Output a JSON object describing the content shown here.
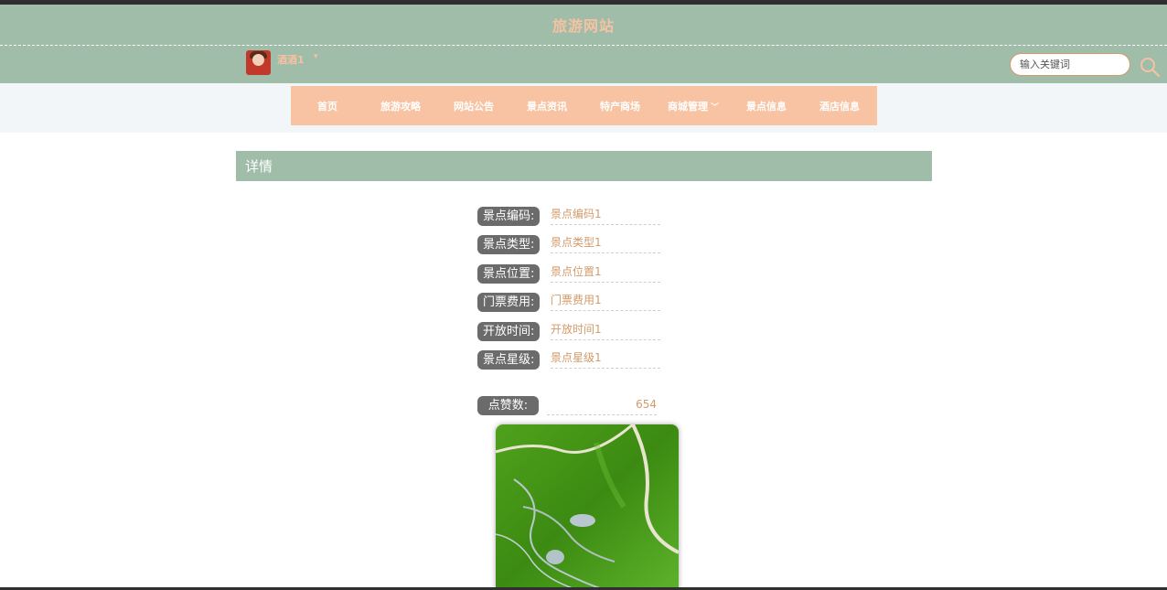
{
  "header": {
    "site_title": "旅游网站",
    "username": "酒酒1",
    "user_caret": "▾",
    "search_placeholder": "输入关键词"
  },
  "nav": {
    "items": [
      {
        "label": "首页"
      },
      {
        "label": "旅游攻略"
      },
      {
        "label": "网站公告"
      },
      {
        "label": "景点资讯"
      },
      {
        "label": "特产商场"
      },
      {
        "label": "商城管理",
        "has_dropdown": true
      },
      {
        "label": "景点信息"
      },
      {
        "label": "酒店信息"
      }
    ],
    "dropdown_icon": "chevron-down-icon"
  },
  "detail": {
    "panel_title": "详情",
    "fields": [
      {
        "label": "景点编码:",
        "value": "景点编码1"
      },
      {
        "label": "景点类型:",
        "value": "景点类型1"
      },
      {
        "label": "景点位置:",
        "value": "景点位置1"
      },
      {
        "label": "门票费用:",
        "value": "门票费用1"
      },
      {
        "label": "开放时间:",
        "value": "开放时间1"
      },
      {
        "label": "景点星级:",
        "value": "景点星级1"
      }
    ],
    "likes_label": "点赞数:",
    "likes_value": "654"
  },
  "colors": {
    "header_green": "#a0bda9",
    "nav_peach": "#f8c3a2",
    "title_peach": "#f6c2a1",
    "value_orange": "#d39b6b",
    "label_gray": "#6b6b6b"
  },
  "icons": [
    "search-icon",
    "chevron-down-icon",
    "avatar"
  ]
}
